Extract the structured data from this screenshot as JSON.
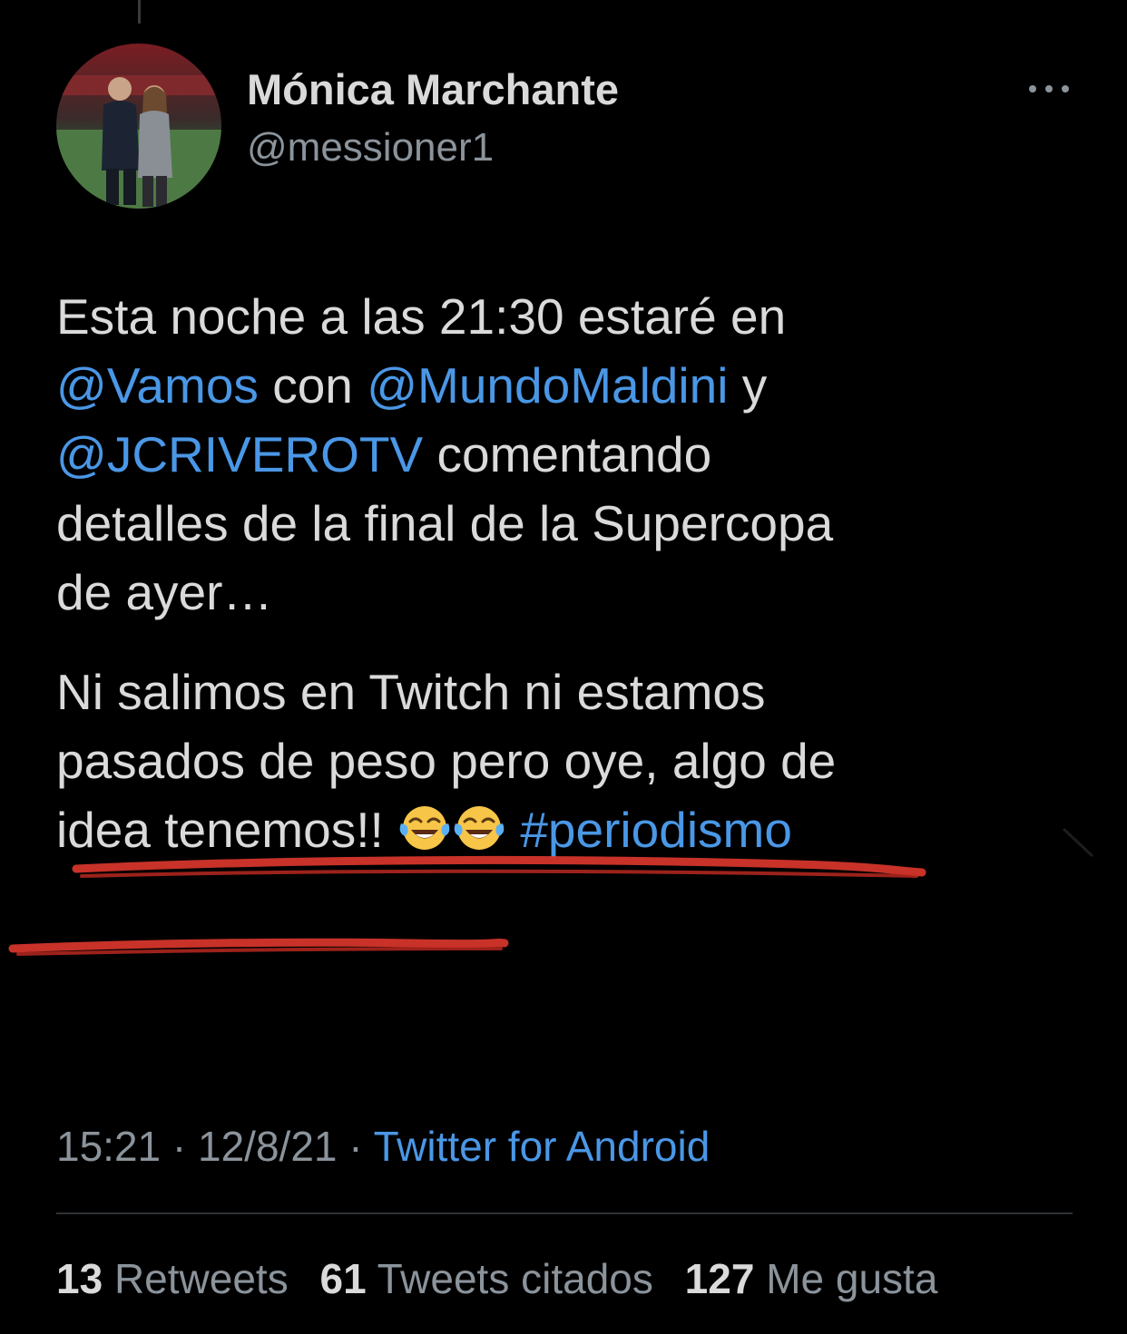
{
  "tweet": {
    "author": {
      "display_name": "Mónica Marchante",
      "handle": "@messioner1"
    },
    "more_icon": "more-horizontal-icon",
    "lines": [
      [
        {
          "t": "Esta noche a las 21:30 estaré en",
          "k": "text"
        }
      ],
      [
        {
          "t": "@Vamos",
          "k": "mention"
        },
        {
          "t": " con ",
          "k": "text"
        },
        {
          "t": "@MundoMaldini",
          "k": "mention"
        },
        {
          "t": " y",
          "k": "text"
        }
      ],
      [
        {
          "t": "@JCRIVEROTV",
          "k": "mention"
        },
        {
          "t": " comentando",
          "k": "text"
        }
      ],
      [
        {
          "t": "detalles de la final de la Supercopa",
          "k": "text"
        }
      ],
      [
        {
          "t": "de ayer…",
          "k": "text"
        }
      ],
      [
        {
          "t": "Ni salimos en Twitch ni estamos",
          "k": "text"
        }
      ],
      [
        {
          "t": "pasados de peso pero oye, algo de",
          "k": "text"
        }
      ],
      [
        {
          "t": "idea tenemos!! ",
          "k": "text"
        },
        {
          "t": "😂",
          "k": "emoji"
        },
        {
          "t": "😂",
          "k": "emoji"
        },
        {
          "t": " ",
          "k": "text"
        },
        {
          "t": "#periodismo",
          "k": "hashtag"
        }
      ]
    ],
    "time": "15:21",
    "date": "12/8/21",
    "separator": "·",
    "source": "Twitter for Android",
    "stats": [
      {
        "count": "13",
        "label": "Retweets"
      },
      {
        "count": "61",
        "label": "Tweets citados"
      },
      {
        "count": "127",
        "label": "Me gusta"
      }
    ]
  },
  "colors": {
    "background": "#000000",
    "text": "#dadada",
    "secondary": "#8b939b",
    "link": "#4a97e6",
    "scribble": "#d9362b"
  }
}
